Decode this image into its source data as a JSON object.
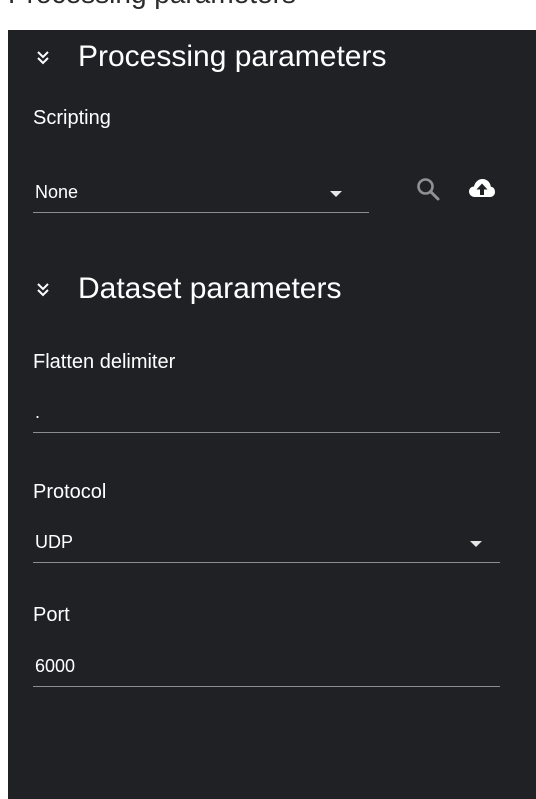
{
  "header_clip": {
    "text": "Processing parameters"
  },
  "sections": {
    "processing": {
      "title": "Processing parameters",
      "scripting": {
        "label": "Scripting",
        "value": "None"
      }
    },
    "dataset": {
      "title": "Dataset parameters",
      "flatten_delimiter": {
        "label": "Flatten delimiter",
        "value": "."
      },
      "protocol": {
        "label": "Protocol",
        "value": "UDP"
      },
      "port": {
        "label": "Port",
        "value": "6000"
      }
    }
  },
  "icons": {
    "collapse": "chevron-double-down-icon",
    "search": "search-icon",
    "upload": "cloud-upload-icon"
  },
  "colors": {
    "panel_bg": "#1f2125",
    "text": "#ffffff",
    "underline": "#8a8d92",
    "search_icon": "#8e9196",
    "upload_icon": "#ffffff"
  }
}
